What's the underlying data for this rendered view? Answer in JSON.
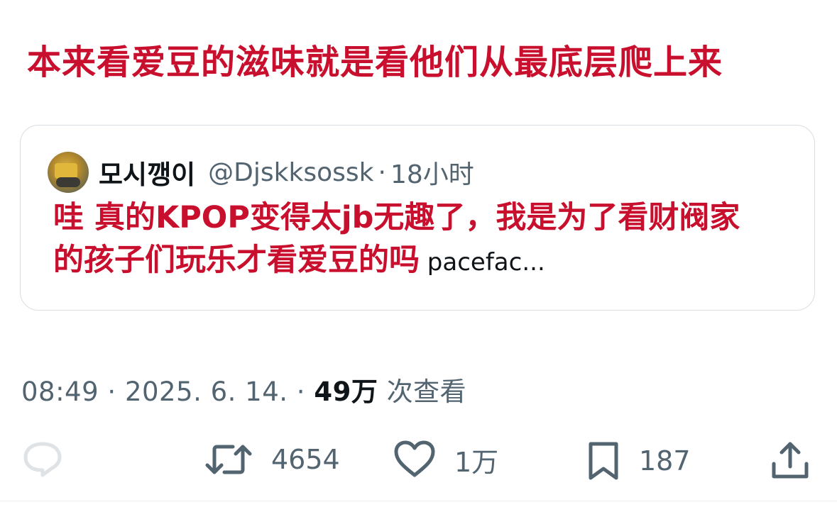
{
  "tweet": {
    "text": "本来看爱豆的滋味就是看他们从最底层爬上来"
  },
  "quoted_tweet": {
    "display_name": "모시깽이",
    "handle": "@Djskksossk",
    "separator": "·",
    "time": "18小时",
    "text_line1": "哇 真的KPOP变得太jb无趣了，我是为了看财阀家",
    "text_line2": "的孩子们玩乐才看爱豆的吗",
    "truncated": " pacefac..."
  },
  "meta": {
    "time": "08:49",
    "separator1": " · ",
    "date": "2025. 6. 14.",
    "separator2": " · ",
    "views_count": "49万",
    "views_label": " 次查看"
  },
  "actions": {
    "reply": {
      "icon": "reply-icon",
      "count": ""
    },
    "retweet": {
      "icon": "retweet-icon",
      "count": "4654"
    },
    "like": {
      "icon": "heart-icon",
      "count": "1万"
    },
    "bookmark": {
      "icon": "bookmark-icon",
      "count": "187"
    },
    "share": {
      "icon": "share-icon",
      "count": ""
    }
  },
  "colors": {
    "highlight_text": "#c8102e",
    "secondary_text": "#536471",
    "primary_text": "#0f1419",
    "border": "#d9dee2"
  }
}
